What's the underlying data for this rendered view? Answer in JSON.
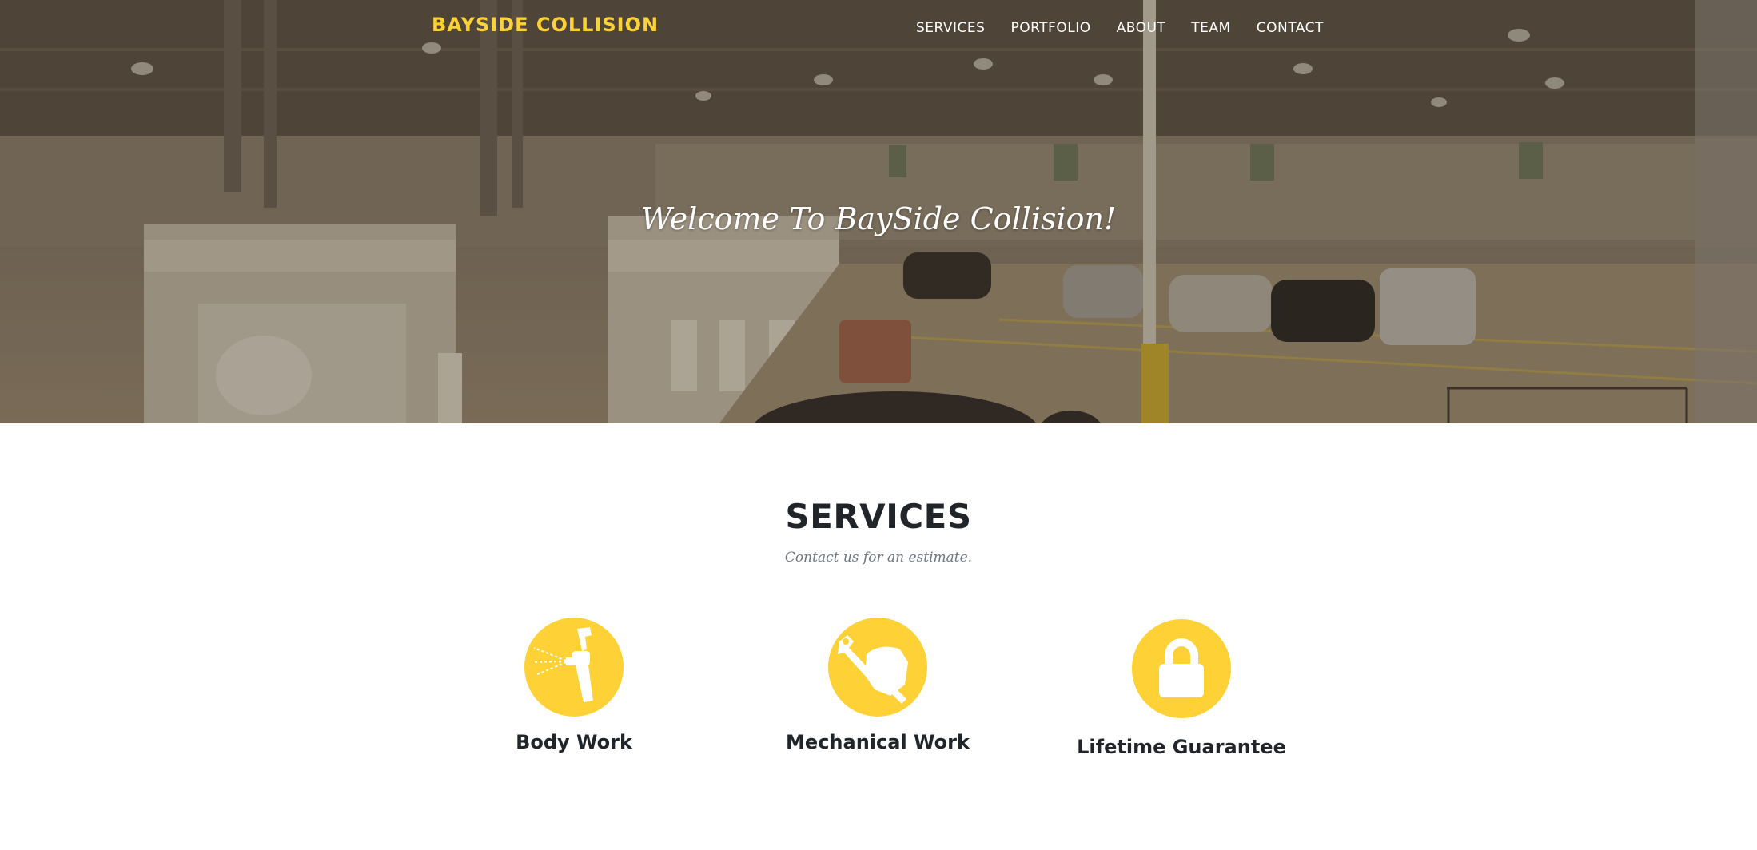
{
  "brand": {
    "name": "BAYSIDE COLLISION",
    "color": "#fed136"
  },
  "nav": {
    "items": [
      {
        "label": "SERVICES"
      },
      {
        "label": "PORTFOLIO"
      },
      {
        "label": "ABOUT"
      },
      {
        "label": "TEAM"
      },
      {
        "label": "CONTACT"
      }
    ]
  },
  "hero": {
    "heading": "Welcome To BaySide Collision!",
    "background": "photo of a collision repair shop interior with paint booths and parked cars"
  },
  "services": {
    "title": "SERVICES",
    "subtitle": "Contact us for an estimate.",
    "items": [
      {
        "title": "Body Work",
        "icon": "spray-gun-icon"
      },
      {
        "title": "Mechanical Work",
        "icon": "wrench-hand-icon"
      },
      {
        "title": "Lifetime Guarantee",
        "icon": "lock-icon"
      }
    ]
  },
  "colors": {
    "accent": "#fed136",
    "heading": "#212529",
    "muted": "#6c757d"
  }
}
